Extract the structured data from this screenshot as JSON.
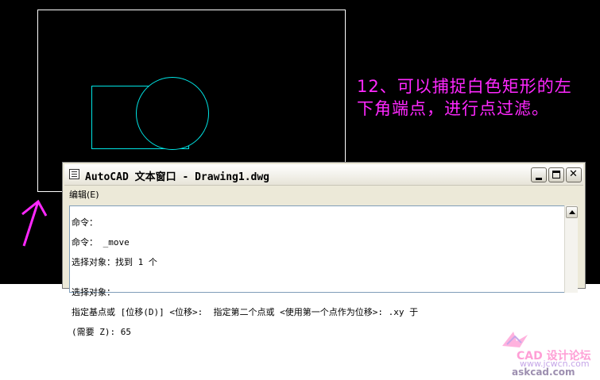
{
  "drawing": {
    "colors": {
      "background": "#000000",
      "rectangle": "#ffffff",
      "geometry": "#00e5e5",
      "annotation": "#ff28ff"
    }
  },
  "annotation": {
    "line1": "12、可以捕捉白色矩形的左",
    "line2": "下角端点，进行点过滤。"
  },
  "text_window": {
    "title": "AutoCAD 文本窗口 - Drawing1.dwg",
    "menu": {
      "edit_label": "编辑(E)"
    },
    "lines": [
      "命令：",
      "命令： _move",
      "选择对象：找到 1 个",
      "",
      "选择对象：",
      "指定基点或 [位移(D)] <位移>:  指定第二个点或 <使用第一个点作为位移>: .xy 于",
      "(需要 Z): 65"
    ]
  },
  "watermark": {
    "line1": "CAD 设计论坛",
    "line2": "www.jcwcn.com",
    "line3": "askcad.com"
  }
}
